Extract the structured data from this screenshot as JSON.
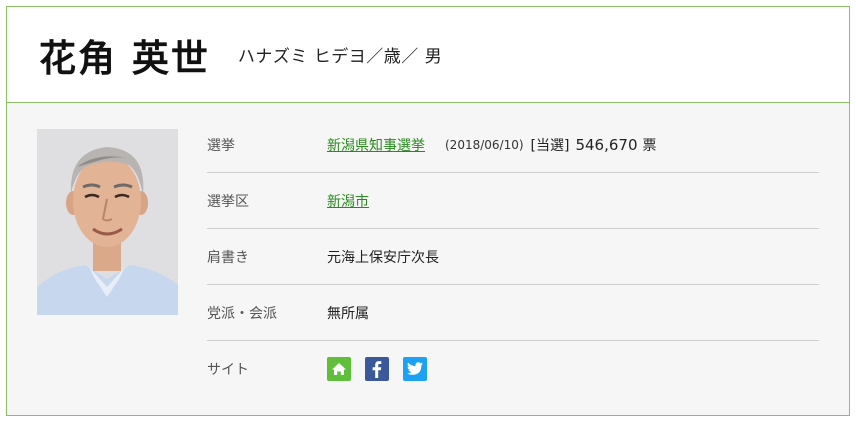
{
  "profile": {
    "name": "花角 英世",
    "kana": "ハナズミ ヒデヨ／歳／ 男",
    "photo_alt": "花角 英世"
  },
  "details": {
    "election": {
      "label": "選挙",
      "link": "新潟県知事選挙",
      "date": "(2018/06/10)",
      "result": "[当選]",
      "votes": "546,670",
      "unit": "票"
    },
    "district": {
      "label": "選挙区",
      "link": "新潟市"
    },
    "title": {
      "label": "肩書き",
      "value": "元海上保安庁次長"
    },
    "party": {
      "label": "党派・会派",
      "value": "無所属"
    },
    "site": {
      "label": "サイト",
      "icons": [
        "home-icon",
        "facebook-icon",
        "twitter-icon"
      ]
    }
  },
  "colors": {
    "border": "#8cc068",
    "link": "#2a8a1f",
    "home": "#5fbf3a",
    "facebook": "#3b5998",
    "twitter": "#1da1f2"
  }
}
